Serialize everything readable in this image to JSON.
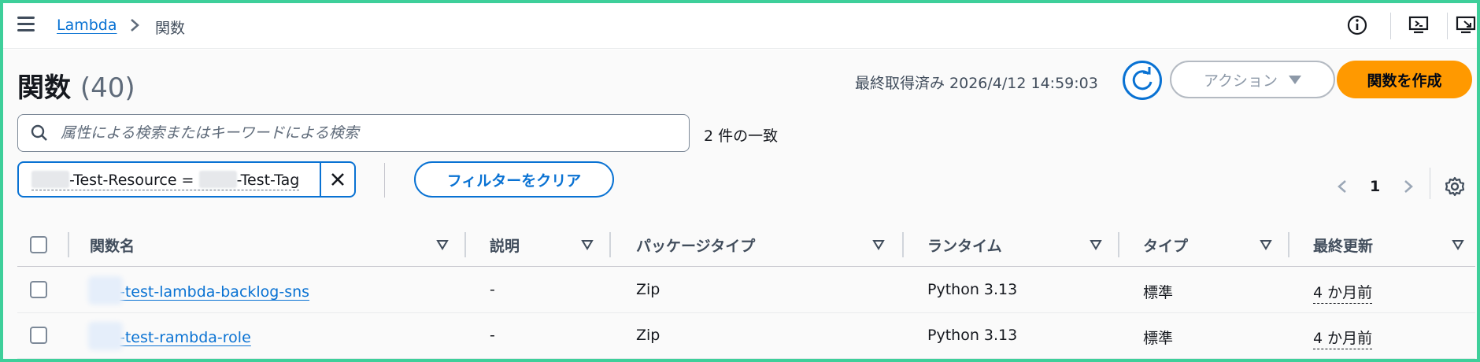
{
  "header": {
    "breadcrumb_link": "Lambda",
    "breadcrumb_current": "関数"
  },
  "page": {
    "title": "関数",
    "count": "(40)",
    "last_fetched": "最終取得済み 2026/4/12 14:59:03",
    "actions_label": "アクション",
    "create_label": "関数を作成"
  },
  "search": {
    "placeholder": "属性による検索またはキーワードによる検索",
    "match_count": "2 件の一致"
  },
  "filter": {
    "token_key_suffix": "-Test-Resource = ",
    "token_value_suffix": "-Test-Tag",
    "clear_label": "フィルターをクリア"
  },
  "pagination": {
    "current_page": "1"
  },
  "table": {
    "columns": [
      "関数名",
      "説明",
      "パッケージタイプ",
      "ランタイム",
      "タイプ",
      "最終更新"
    ],
    "rows": [
      {
        "name": "-test-lambda-backlog-sns",
        "description": "-",
        "package": "Zip",
        "runtime": "Python 3.13",
        "type": "標準",
        "updated": "4 か月前"
      },
      {
        "name": "-test-rambda-role",
        "description": "-",
        "package": "Zip",
        "runtime": "Python 3.13",
        "type": "標準",
        "updated": "4 か月前"
      }
    ]
  },
  "colors": {
    "accent": "#0972d3",
    "primary_button": "#ff9900",
    "frame_border": "#3ecf9a"
  }
}
